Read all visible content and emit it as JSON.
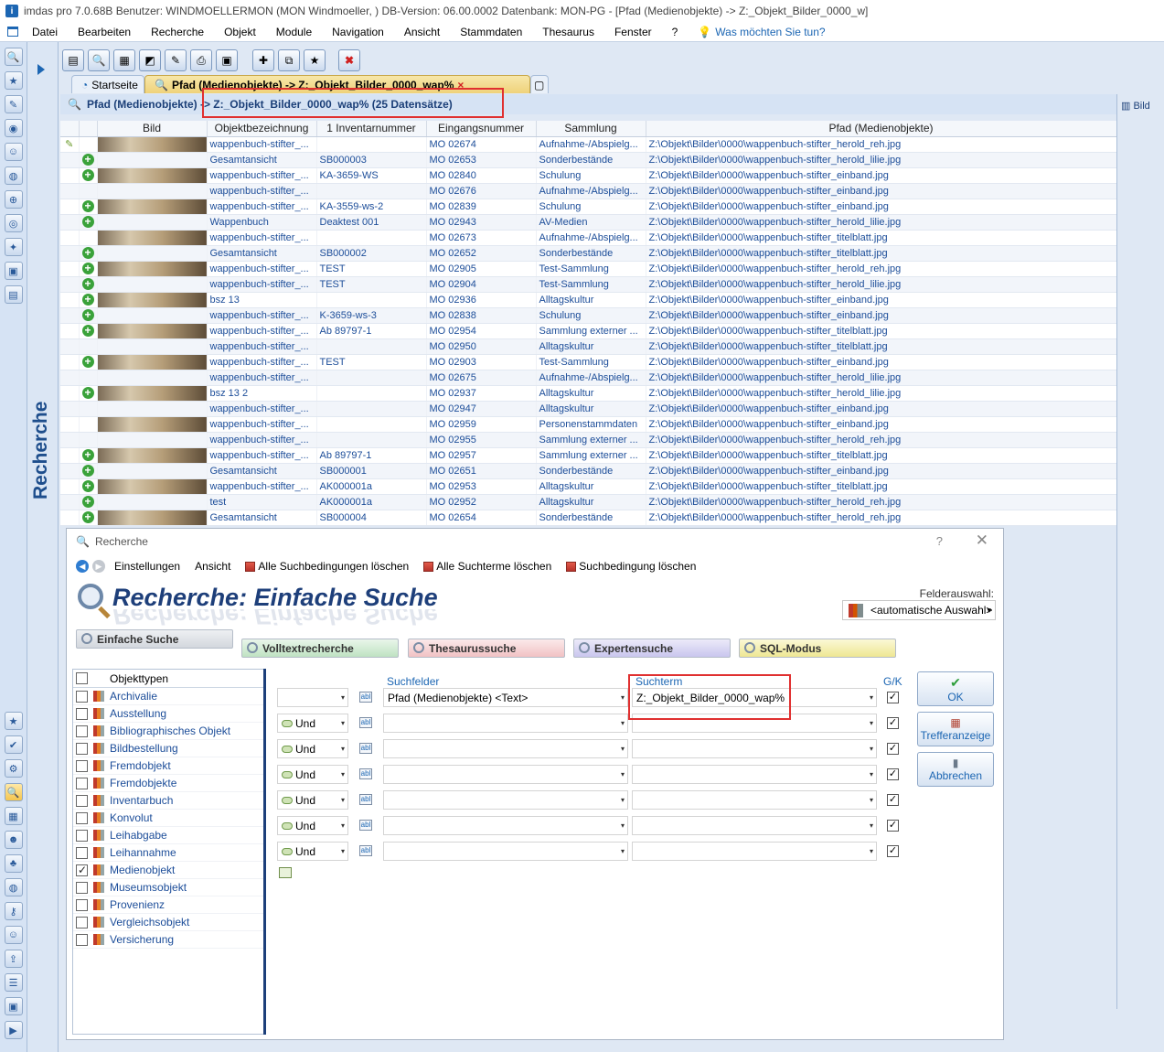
{
  "window": {
    "title": "imdas pro 7.0.68B Benutzer: WINDMOELLERMON (MON Windmoeller, )  DB-Version: 06.00.0002  Datenbank: MON-PG - [Pfad (Medienobjekte) -> Z:_Objekt_Bilder_0000_w]"
  },
  "menu": {
    "items": [
      "Datei",
      "Bearbeiten",
      "Recherche",
      "Objekt",
      "Module",
      "Navigation",
      "Ansicht",
      "Stammdaten",
      "Thesaurus",
      "Fenster",
      "?"
    ],
    "tell": "Was möchten Sie tun?"
  },
  "side": {
    "vertical_label": "Recherche"
  },
  "tabs": {
    "start": "Startseite",
    "active": "Pfad (Medienobjekte) -> Z:_Objekt_Bilder_0000_wap%"
  },
  "result": {
    "header": "Pfad (Medienobjekte) -> Z:_Objekt_Bilder_0000_wap% (25 Datensätze)",
    "side_tab": "Bild"
  },
  "grid": {
    "columns": [
      "Bild",
      "Objektbezeichnung",
      "1 Inventarnummer",
      "Eingangsnummer",
      "Sammlung",
      "Pfad (Medienobjekte)"
    ],
    "rows": [
      {
        "plus": false,
        "o": "wappenbuch-stifter_...",
        "i": "",
        "e": "MO 02674",
        "s": "Aufnahme-/Abspielg...",
        "p": "Z:\\Objekt\\Bilder\\0000\\wappenbuch-stifter_herold_reh.jpg"
      },
      {
        "plus": true,
        "o": "Gesamtansicht",
        "i": "SB000003",
        "e": "MO 02653",
        "s": "Sonderbestände",
        "p": "Z:\\Objekt\\Bilder\\0000\\wappenbuch-stifter_herold_lilie.jpg"
      },
      {
        "plus": true,
        "o": "wappenbuch-stifter_...",
        "i": "KA-3659-WS",
        "e": "MO 02840",
        "s": "Schulung",
        "p": "Z:\\Objekt\\Bilder\\0000\\wappenbuch-stifter_einband.jpg"
      },
      {
        "plus": false,
        "o": "wappenbuch-stifter_...",
        "i": "",
        "e": "MO 02676",
        "s": "Aufnahme-/Abspielg...",
        "p": "Z:\\Objekt\\Bilder\\0000\\wappenbuch-stifter_einband.jpg"
      },
      {
        "plus": true,
        "o": "wappenbuch-stifter_...",
        "i": "KA-3559-ws-2",
        "e": "MO 02839",
        "s": "Schulung",
        "p": "Z:\\Objekt\\Bilder\\0000\\wappenbuch-stifter_einband.jpg"
      },
      {
        "plus": true,
        "o": "Wappenbuch",
        "i": "Deaktest 001",
        "e": "MO 02943",
        "s": "AV-Medien",
        "p": "Z:\\Objekt\\Bilder\\0000\\wappenbuch-stifter_herold_lilie.jpg"
      },
      {
        "plus": false,
        "o": "wappenbuch-stifter_...",
        "i": "",
        "e": "MO 02673",
        "s": "Aufnahme-/Abspielg...",
        "p": "Z:\\Objekt\\Bilder\\0000\\wappenbuch-stifter_titelblatt.jpg"
      },
      {
        "plus": true,
        "o": "Gesamtansicht",
        "i": "SB000002",
        "e": "MO 02652",
        "s": "Sonderbestände",
        "p": "Z:\\Objekt\\Bilder\\0000\\wappenbuch-stifter_titelblatt.jpg"
      },
      {
        "plus": true,
        "o": "wappenbuch-stifter_...",
        "i": "TEST",
        "e": "MO 02905",
        "s": "Test-Sammlung",
        "p": "Z:\\Objekt\\Bilder\\0000\\wappenbuch-stifter_herold_reh.jpg"
      },
      {
        "plus": true,
        "o": "wappenbuch-stifter_...",
        "i": "TEST",
        "e": "MO 02904",
        "s": "Test-Sammlung",
        "p": "Z:\\Objekt\\Bilder\\0000\\wappenbuch-stifter_herold_lilie.jpg"
      },
      {
        "plus": true,
        "o": "bsz 13",
        "i": "",
        "e": "MO 02936",
        "s": "Alltagskultur",
        "p": "Z:\\Objekt\\Bilder\\0000\\wappenbuch-stifter_einband.jpg"
      },
      {
        "plus": true,
        "o": "wappenbuch-stifter_...",
        "i": "K-3659-ws-3",
        "e": "MO 02838",
        "s": "Schulung",
        "p": "Z:\\Objekt\\Bilder\\0000\\wappenbuch-stifter_einband.jpg"
      },
      {
        "plus": true,
        "o": "wappenbuch-stifter_...",
        "i": "Ab 89797-1",
        "e": "MO 02954",
        "s": "Sammlung externer ...",
        "p": "Z:\\Objekt\\Bilder\\0000\\wappenbuch-stifter_titelblatt.jpg"
      },
      {
        "plus": false,
        "o": "wappenbuch-stifter_...",
        "i": "",
        "e": "MO 02950",
        "s": "Alltagskultur",
        "p": "Z:\\Objekt\\Bilder\\0000\\wappenbuch-stifter_titelblatt.jpg"
      },
      {
        "plus": true,
        "o": "wappenbuch-stifter_...",
        "i": "TEST",
        "e": "MO 02903",
        "s": "Test-Sammlung",
        "p": "Z:\\Objekt\\Bilder\\0000\\wappenbuch-stifter_einband.jpg"
      },
      {
        "plus": false,
        "o": "wappenbuch-stifter_...",
        "i": "",
        "e": "MO 02675",
        "s": "Aufnahme-/Abspielg...",
        "p": "Z:\\Objekt\\Bilder\\0000\\wappenbuch-stifter_herold_lilie.jpg"
      },
      {
        "plus": true,
        "o": "bsz 13 2",
        "i": "",
        "e": "MO 02937",
        "s": "Alltagskultur",
        "p": "Z:\\Objekt\\Bilder\\0000\\wappenbuch-stifter_herold_lilie.jpg"
      },
      {
        "plus": false,
        "o": "wappenbuch-stifter_...",
        "i": "",
        "e": "MO 02947",
        "s": "Alltagskultur",
        "p": "Z:\\Objekt\\Bilder\\0000\\wappenbuch-stifter_einband.jpg"
      },
      {
        "plus": false,
        "o": "wappenbuch-stifter_...",
        "i": "",
        "e": "MO 02959",
        "s": "Personenstammdaten",
        "p": "Z:\\Objekt\\Bilder\\0000\\wappenbuch-stifter_einband.jpg"
      },
      {
        "plus": false,
        "o": "wappenbuch-stifter_...",
        "i": "",
        "e": "MO 02955",
        "s": "Sammlung externer ...",
        "p": "Z:\\Objekt\\Bilder\\0000\\wappenbuch-stifter_herold_reh.jpg"
      },
      {
        "plus": true,
        "o": "wappenbuch-stifter_...",
        "i": "Ab 89797-1",
        "e": "MO 02957",
        "s": "Sammlung externer ...",
        "p": "Z:\\Objekt\\Bilder\\0000\\wappenbuch-stifter_titelblatt.jpg"
      },
      {
        "plus": true,
        "o": "Gesamtansicht",
        "i": "SB000001",
        "e": "MO 02651",
        "s": "Sonderbestände",
        "p": "Z:\\Objekt\\Bilder\\0000\\wappenbuch-stifter_einband.jpg"
      },
      {
        "plus": true,
        "o": "wappenbuch-stifter_...",
        "i": "AK000001a",
        "e": "MO 02953",
        "s": "Alltagskultur",
        "p": "Z:\\Objekt\\Bilder\\0000\\wappenbuch-stifter_titelblatt.jpg"
      },
      {
        "plus": true,
        "o": "test",
        "i": "AK000001a",
        "e": "MO 02952",
        "s": "Alltagskultur",
        "p": "Z:\\Objekt\\Bilder\\0000\\wappenbuch-stifter_herold_reh.jpg"
      },
      {
        "plus": true,
        "o": "Gesamtansicht",
        "i": "SB000004",
        "e": "MO 02654",
        "s": "Sonderbestände",
        "p": "Z:\\Objekt\\Bilder\\0000\\wappenbuch-stifter_herold_reh.jpg"
      }
    ]
  },
  "dialog": {
    "title": "Recherche",
    "help": "?",
    "close": "✕",
    "toolbar": {
      "settings": "Einstellungen",
      "view": "Ansicht",
      "clear_all_conditions": "Alle Suchbedingungen löschen",
      "clear_all_terms": "Alle Suchterme löschen",
      "clear_condition": "Suchbedingung löschen"
    },
    "heading": "Recherche: Einfache Suche",
    "felder_label": "Felderauswahl:",
    "felder_value": "<automatische Auswahl>",
    "modes": {
      "simple": "Einfache Suche",
      "fulltext": "Volltextrecherche",
      "thesaurus": "Thesaurussuche",
      "expert": "Expertensuche",
      "sql": "SQL-Modus"
    },
    "objekttypen_header": "Objekttypen",
    "objekttypen": [
      {
        "label": "Archivalie",
        "checked": false
      },
      {
        "label": "Ausstellung",
        "checked": false
      },
      {
        "label": "Bibliographisches Objekt",
        "checked": false
      },
      {
        "label": "Bildbestellung",
        "checked": false
      },
      {
        "label": "Fremdobjekt",
        "checked": false
      },
      {
        "label": "Fremdobjekte",
        "checked": false
      },
      {
        "label": "Inventarbuch",
        "checked": false
      },
      {
        "label": "Konvolut",
        "checked": false
      },
      {
        "label": "Leihabgabe",
        "checked": false
      },
      {
        "label": "Leihannahme",
        "checked": false
      },
      {
        "label": "Medienobjekt",
        "checked": true
      },
      {
        "label": "Museumsobjekt",
        "checked": false
      },
      {
        "label": "Provenienz",
        "checked": false
      },
      {
        "label": "Vergleichsobjekt",
        "checked": false
      },
      {
        "label": "Versicherung",
        "checked": false
      }
    ],
    "col_suchfelder": "Suchfelder",
    "col_suchterm": "Suchterm",
    "col_gk": "G/K",
    "first_field": "Pfad (Medienobjekte) <Text>",
    "first_term": "Z:_Objekt_Bilder_0000_wap%",
    "und": "Und",
    "abl": "abl",
    "ok": "OK",
    "treffer": "Trefferanzeige",
    "abbrechen": "Abbrechen"
  }
}
